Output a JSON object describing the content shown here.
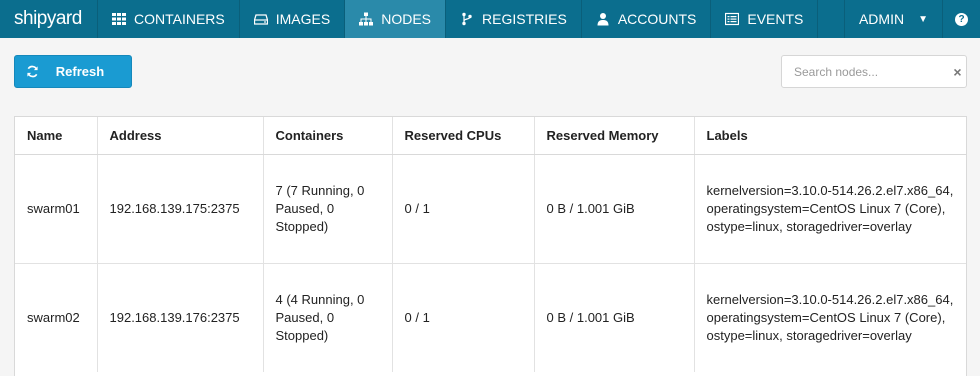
{
  "nav": {
    "brand": "shipyard",
    "items": [
      {
        "label": "CONTAINERS",
        "icon": "grid-icon"
      },
      {
        "label": "IMAGES",
        "icon": "hdd-icon"
      },
      {
        "label": "NODES",
        "icon": "sitemap-icon"
      },
      {
        "label": "REGISTRIES",
        "icon": "branch-icon"
      },
      {
        "label": "ACCOUNTS",
        "icon": "user-icon"
      },
      {
        "label": "EVENTS",
        "icon": "list-icon"
      }
    ],
    "active": "NODES",
    "user": "ADMIN",
    "help": "?"
  },
  "toolbar": {
    "refresh_label": "Refresh",
    "search_placeholder": "Search nodes...",
    "clear": "×"
  },
  "table": {
    "headers": [
      "Name",
      "Address",
      "Containers",
      "Reserved CPUs",
      "Reserved Memory",
      "Labels"
    ],
    "rows": [
      {
        "name": "swarm01",
        "address": "192.168.139.175:2375",
        "containers": "7 (7 Running, 0 Paused, 0 Stopped)",
        "cpus": "0 / 1",
        "memory": "0 B / 1.001 GiB",
        "labels": "kernelversion=3.10.0-514.26.2.el7.x86_64, operatingsystem=CentOS Linux 7 (Core), ostype=linux, storagedriver=overlay"
      },
      {
        "name": "swarm02",
        "address": "192.168.139.176:2375",
        "containers": "4 (4 Running, 0 Paused, 0 Stopped)",
        "cpus": "0 / 1",
        "memory": "0 B / 1.001 GiB",
        "labels": "kernelversion=3.10.0-514.26.2.el7.x86_64, operatingsystem=CentOS Linux 7 (Core), ostype=linux, storagedriver=overlay"
      }
    ]
  },
  "colors": {
    "navbar": "#0b6e8e",
    "nav_active": "#2a8aaa",
    "button": "#1a9bd2",
    "background": "#f5f5f5"
  }
}
